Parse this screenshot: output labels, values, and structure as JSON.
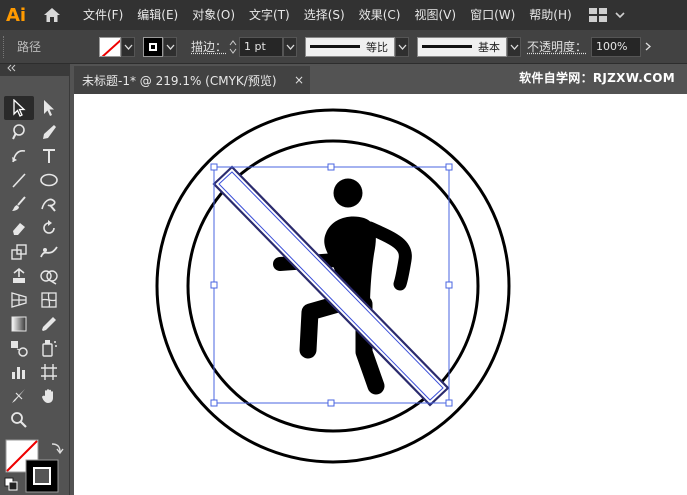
{
  "app": {
    "logo": "Ai"
  },
  "menu": [
    "文件(F)",
    "编辑(E)",
    "对象(O)",
    "文字(T)",
    "选择(S)",
    "效果(C)",
    "视图(V)",
    "窗口(W)",
    "帮助(H)"
  ],
  "control_bar": {
    "selection_type": "路径",
    "stroke_label": "描边：",
    "stroke_weight": "1 pt",
    "profile_label": "等比",
    "brush_label": "基本",
    "opacity_label": "不透明度：",
    "opacity_value": "100%"
  },
  "document_tab": {
    "title": "未标题-1* @ 219.1% (CMYK/预览)",
    "close": "×"
  },
  "watermark": "软件自学网：RJZXW.COM",
  "colors": {
    "accent": "#ff9a00",
    "selection": "#3b4fd9",
    "panel": "#535353",
    "menubar": "#323232"
  },
  "icons": {
    "tools": [
      "selection-tool-icon",
      "direct-selection-tool-icon",
      "magic-wand-tool-icon",
      "pen-tool-icon",
      "curvature-tool-icon",
      "type-tool-icon",
      "line-tool-icon",
      "ellipse-tool-icon",
      "paintbrush-tool-icon",
      "shaper-tool-icon",
      "eraser-tool-icon",
      "rotate-tool-icon",
      "scale-tool-icon",
      "puppet-warp-tool-icon",
      "free-transform-tool-icon",
      "shape-builder-tool-icon",
      "perspective-grid-tool-icon",
      "mesh-tool-icon",
      "gradient-tool-icon",
      "eyedropper-tool-icon",
      "blend-tool-icon",
      "symbol-sprayer-tool-icon",
      "column-graph-tool-icon",
      "artboard-tool-icon",
      "slice-tool-icon",
      "hand-tool-icon",
      "zoom-tool-icon"
    ]
  }
}
